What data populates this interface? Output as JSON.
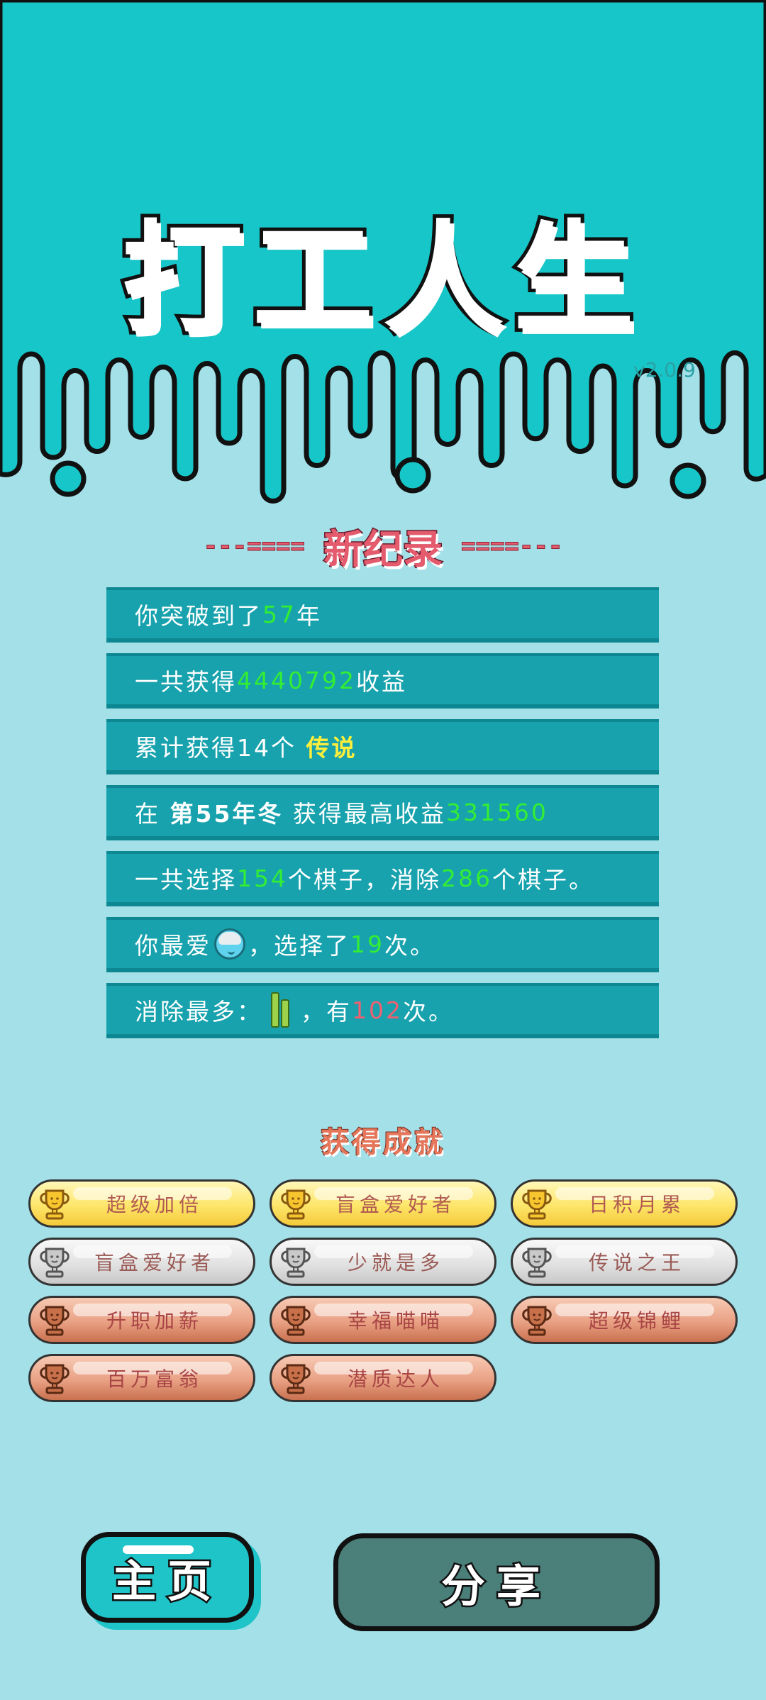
{
  "game_title": "打工人生",
  "version": "v2.0.9",
  "record_section": {
    "title": "新纪录",
    "dash_left": "---====",
    "dash_right": "====---"
  },
  "stats": [
    {
      "pre": "你突破到了",
      "num": "57",
      "post": "年"
    },
    {
      "pre": "一共获得",
      "num": "4440792",
      "post": "收益"
    },
    {
      "pre": "累计获得14个 ",
      "legend": "传说"
    },
    {
      "pre": "在 ",
      "season": "第55年冬",
      "mid": " 获得最高收益",
      "num": "331560"
    },
    {
      "pre": "一共选择",
      "num1": "154",
      "mid": "个棋子，消除",
      "num2": "286",
      "post": "个棋子。"
    },
    {
      "pre": "你最爱",
      "icon": "rice-bowl-icon",
      "mid": "，选择了",
      "num": "19",
      "post": "次。"
    },
    {
      "pre": "消除最多：",
      "icon": "bamboo-icon",
      "mid": "，有",
      "num": "102",
      "post": "次。"
    }
  ],
  "achievements_title": "获得成就",
  "achievements": [
    {
      "label": "超级加倍",
      "tier": "gold"
    },
    {
      "label": "盲盒爱好者",
      "tier": "gold"
    },
    {
      "label": "日积月累",
      "tier": "gold"
    },
    {
      "label": "盲盒爱好者",
      "tier": "silver"
    },
    {
      "label": "少就是多",
      "tier": "silver"
    },
    {
      "label": "传说之王",
      "tier": "silver"
    },
    {
      "label": "升职加薪",
      "tier": "bronze"
    },
    {
      "label": "幸福喵喵",
      "tier": "bronze"
    },
    {
      "label": "超级锦鲤",
      "tier": "bronze"
    },
    {
      "label": "百万富翁",
      "tier": "bronze"
    },
    {
      "label": "潜质达人",
      "tier": "bronze"
    }
  ],
  "buttons": {
    "home": "主页",
    "share": "分享"
  },
  "colors": {
    "header_bg": "#17c6c8",
    "page_bg": "#a3e0e8",
    "stat_row_bg": "#17a2ad",
    "value_green": "#33ee33",
    "value_red": "#f06070",
    "legend_yellow": "#ffef3a",
    "record_red": "#e45b6e",
    "share_button": "#4a7f7a"
  }
}
